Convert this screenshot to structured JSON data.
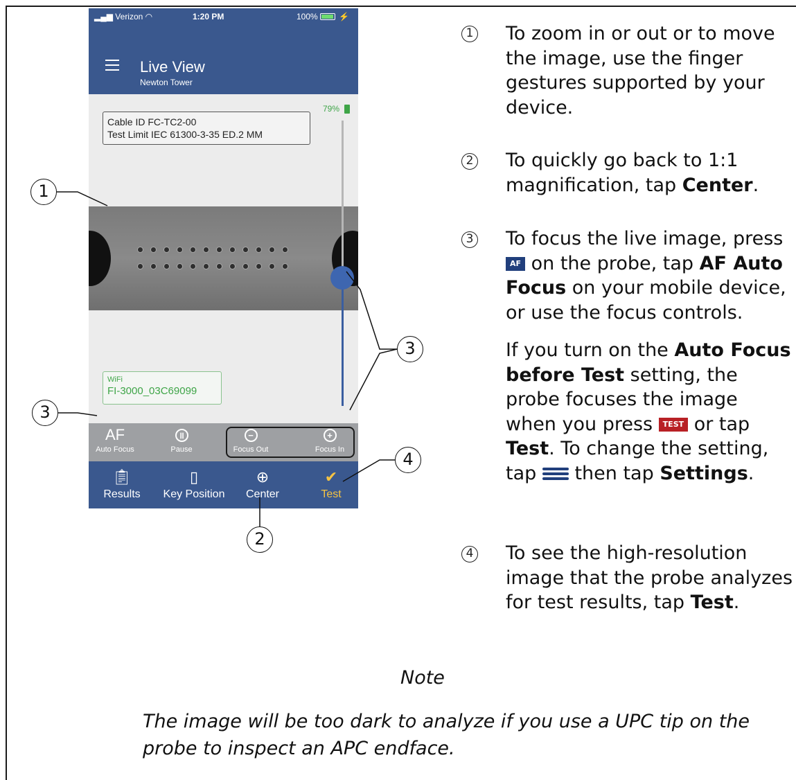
{
  "phone": {
    "status": {
      "carrier": "Verizon",
      "time": "1:20 PM",
      "battery": "100%"
    },
    "header": {
      "title": "Live View",
      "subtitle": "Newton Tower"
    },
    "info": {
      "cable_id": "Cable ID FC-TC2-00",
      "test_limit": "Test Limit IEC 61300-3-35 ED.2 MM"
    },
    "probe_battery": "79%",
    "focus_level_fraction": 0.45,
    "wifi": {
      "label": "WiFi",
      "ssid": "FI-3000_03C69099"
    },
    "controls": [
      {
        "glyph": "AF",
        "label": "Auto Focus"
      },
      {
        "glyph": "pause-icon",
        "label": "Pause"
      },
      {
        "glyph": "minus-circle-icon",
        "label": "Focus Out"
      },
      {
        "glyph": "plus-circle-icon",
        "label": "Focus In"
      }
    ],
    "tabs": [
      {
        "icon": "clipboard-icon",
        "label": "Results"
      },
      {
        "icon": "key-position-icon",
        "label": "Key Position"
      },
      {
        "icon": "crosshair-icon",
        "label": "Center"
      },
      {
        "icon": "checkmark-icon",
        "label": "Test",
        "color": "#f5c343"
      }
    ]
  },
  "callouts": [
    "1",
    "2",
    "3",
    "3",
    "4"
  ],
  "steps": [
    {
      "num": "1",
      "text": "To zoom in or out or to move the image, use the finger gestures supported by your device."
    },
    {
      "num": "2",
      "text_before": "To quickly go back to 1:1 magnification, tap ",
      "bold": "Center",
      "text_after": "."
    },
    {
      "num": "3",
      "p1_a": "To focus the live image, press ",
      "key_af": "AF",
      "p1_b": " on the probe, tap ",
      "p1_bold": "AF Auto Focus",
      "p1_c": " on your mobile device, or use the focus controls.",
      "p2_a": "If you turn on the ",
      "p2_bold1": "Auto Focus before Test",
      "p2_b": " setting, the probe focuses the image when you press ",
      "key_test": "TEST",
      "p2_c": " or tap ",
      "p2_bold2": "Test",
      "p2_d": ". To change the setting, tap ",
      "p2_e": " then tap ",
      "p2_bold3": "Settings",
      "p2_f": "."
    },
    {
      "num": "4",
      "text_before": "To see the high-resolution image that the probe analyzes for test results, tap ",
      "bold": "Test",
      "text_after": "."
    }
  ],
  "note": {
    "heading": "Note",
    "body": "The image will be too dark to analyze if you use a UPC tip on the probe to inspect an APC endface."
  },
  "colors": {
    "header_blue": "#3a588e",
    "key_blue": "#213f7c",
    "key_red": "#b82025",
    "wifi_green": "#3fa548",
    "test_yellow": "#f5c343"
  }
}
